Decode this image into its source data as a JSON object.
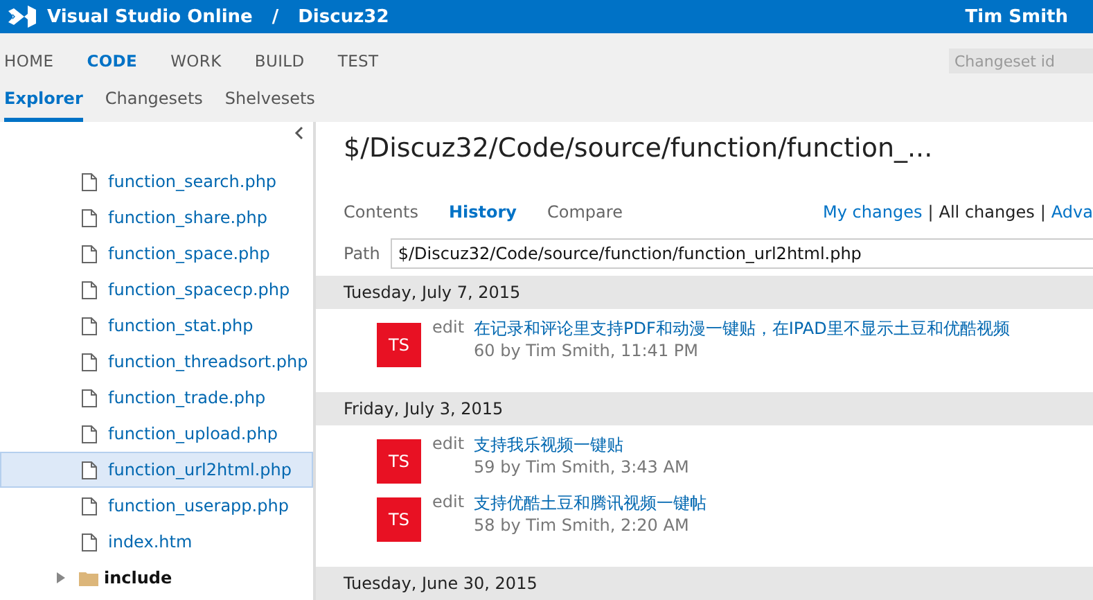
{
  "header": {
    "product": "Visual Studio Online",
    "separator": "/",
    "project": "Discuz32",
    "user": "Tim Smith"
  },
  "main_nav": [
    {
      "label": "HOME",
      "selected": false
    },
    {
      "label": "CODE",
      "selected": true
    },
    {
      "label": "WORK",
      "selected": false
    },
    {
      "label": "BUILD",
      "selected": false
    },
    {
      "label": "TEST",
      "selected": false
    }
  ],
  "changeset_search": {
    "placeholder": "Changeset id"
  },
  "sub_nav": [
    {
      "label": "Explorer",
      "selected": true
    },
    {
      "label": "Changesets",
      "selected": false
    },
    {
      "label": "Shelvesets",
      "selected": false
    }
  ],
  "tree": [
    {
      "kind": "file",
      "label": "function_search.php",
      "selected": false
    },
    {
      "kind": "file",
      "label": "function_share.php",
      "selected": false
    },
    {
      "kind": "file",
      "label": "function_space.php",
      "selected": false
    },
    {
      "kind": "file",
      "label": "function_spacecp.php",
      "selected": false
    },
    {
      "kind": "file",
      "label": "function_stat.php",
      "selected": false
    },
    {
      "kind": "file",
      "label": "function_threadsort.php",
      "selected": false
    },
    {
      "kind": "file",
      "label": "function_trade.php",
      "selected": false
    },
    {
      "kind": "file",
      "label": "function_upload.php",
      "selected": false
    },
    {
      "kind": "file",
      "label": "function_url2html.php",
      "selected": true
    },
    {
      "kind": "file",
      "label": "function_userapp.php",
      "selected": false
    },
    {
      "kind": "file",
      "label": "index.htm",
      "selected": false
    },
    {
      "kind": "folder",
      "label": "include",
      "selected": false,
      "expanded": false
    }
  ],
  "title": "$/Discuz32/Code/source/function/function_...",
  "view_tabs": [
    {
      "label": "Contents",
      "selected": false
    },
    {
      "label": "History",
      "selected": true
    },
    {
      "label": "Compare",
      "selected": false
    }
  ],
  "filters": {
    "separator": "|",
    "items": [
      {
        "label": "My changes",
        "selected": false
      },
      {
        "label": "All changes",
        "selected": true
      },
      {
        "label": "Adva",
        "selected": false
      }
    ]
  },
  "path": {
    "label": "Path",
    "value": "$/Discuz32/Code/source/function/function_url2html.php"
  },
  "history": [
    {
      "date": "Tuesday, July 7, 2015",
      "commits": [
        {
          "avatar": "TS",
          "action": "edit",
          "message": "在记录和评论里支持PDF和动漫一键贴，在IPAD里不显示土豆和优酷视频",
          "detail": "60 by Tim Smith, 11:41 PM"
        }
      ]
    },
    {
      "date": "Friday, July 3, 2015",
      "commits": [
        {
          "avatar": "TS",
          "action": "edit",
          "message": "支持我乐视频一键贴",
          "detail": "59 by Tim Smith, 3:43 AM"
        },
        {
          "avatar": "TS",
          "action": "edit",
          "message": "支持优酷土豆和腾讯视频一键帖",
          "detail": "58 by Tim Smith, 2:20 AM"
        }
      ]
    },
    {
      "date": "Tuesday, June 30, 2015"
    }
  ]
}
